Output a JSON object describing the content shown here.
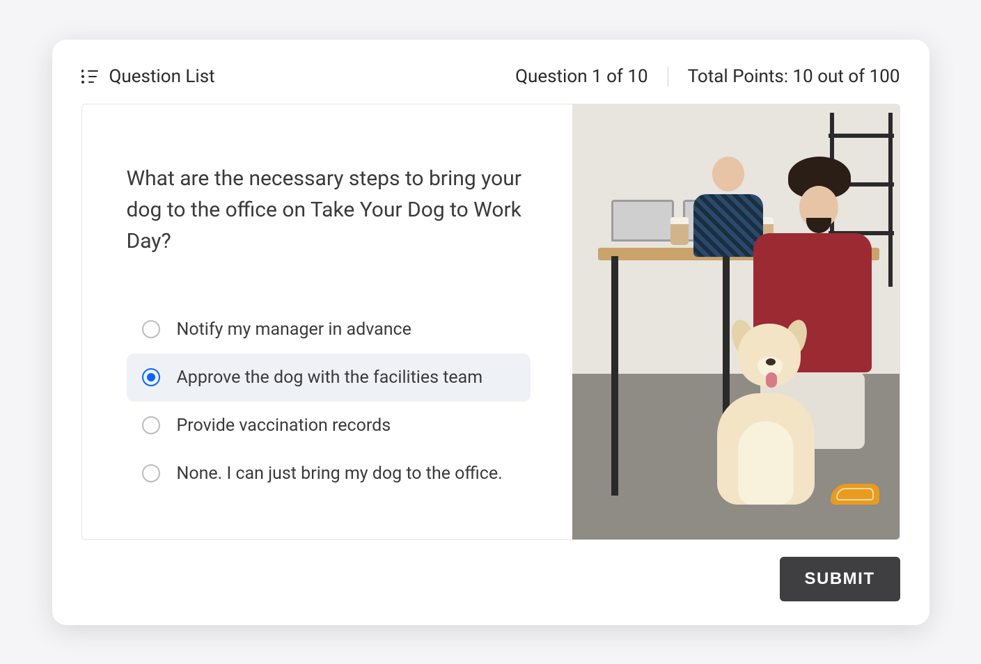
{
  "header": {
    "question_list_label": "Question List",
    "progress_label": "Question 1 of 10",
    "points_label": "Total Points: 10 out of 100"
  },
  "question": {
    "text": "What are the necessary steps to bring your dog to the office on Take Your Dog to Work Day?",
    "options": [
      {
        "label": "Notify my manager in advance",
        "selected": false
      },
      {
        "label": "Approve the dog with the facilities team",
        "selected": true
      },
      {
        "label": "Provide vaccination records",
        "selected": false
      },
      {
        "label": "None. I can just bring my dog to the office.",
        "selected": false
      }
    ],
    "image_description": "Man in maroon shirt petting a golden retriever in an office with laptops, coffee cups, a coworker, and shelving."
  },
  "footer": {
    "submit_label": "SUBMIT"
  }
}
